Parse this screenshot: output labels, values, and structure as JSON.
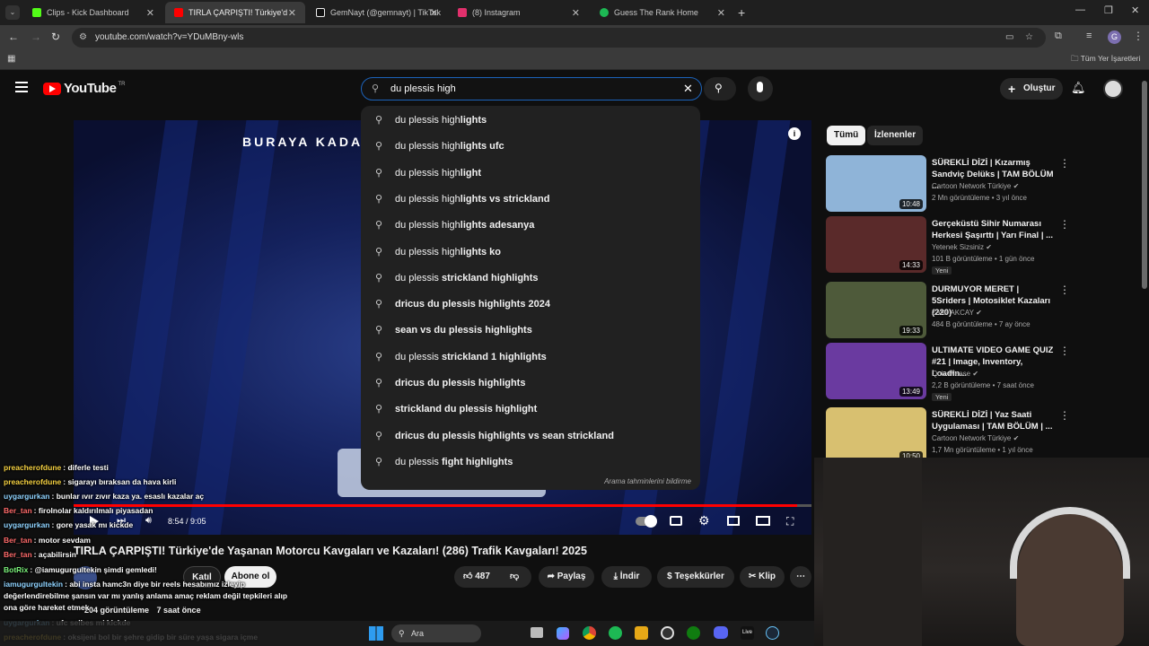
{
  "browser": {
    "tabs": [
      {
        "title": "Clips - Kick Dashboard",
        "icon": "kick-icon",
        "color": "#53fc18"
      },
      {
        "title": "TIRLA ÇARPIŞTI! Türkiye'de Yaşa",
        "icon": "youtube-icon",
        "color": "#ff0000",
        "active": true
      },
      {
        "title": "GemNayt (@gemnayt) | TikTok",
        "icon": "tiktok-icon",
        "color": "#ffffff"
      },
      {
        "title": "(8) Instagram",
        "icon": "instagram-icon",
        "color": "#e1306c"
      },
      {
        "title": "Guess The Rank Home",
        "icon": "spotify-icon",
        "color": "#1db954"
      }
    ],
    "url": "youtube.com/watch?v=YDuMBny-wls",
    "bookmarks_label": "Tüm Yer İşaretleri",
    "profile_initial": "G"
  },
  "header": {
    "logo_text": "YouTube",
    "country": "TR",
    "search_value": "du plessis high",
    "create_label": "Oluştur"
  },
  "suggestions": [
    {
      "pre": "du plessis high",
      "bold": "lights"
    },
    {
      "pre": "du plessis high",
      "bold": "lights ufc"
    },
    {
      "pre": "du plessis high",
      "bold": "light"
    },
    {
      "pre": "du plessis high",
      "bold": "lights vs strickland"
    },
    {
      "pre": "du plessis high",
      "bold": "lights adesanya"
    },
    {
      "pre": "du plessis high",
      "bold": "lights ko"
    },
    {
      "pre": "du plessis ",
      "bold": "strickland highlights"
    },
    {
      "pre": "",
      "bold": "dricus du plessis highlights 2024"
    },
    {
      "pre": "",
      "bold": "sean vs du plessis highlights"
    },
    {
      "pre": "du plessis ",
      "bold": "strickland 1 highlights"
    },
    {
      "pre": "",
      "bold": "dricus du plessis highlights"
    },
    {
      "pre": "",
      "bold": "strickland du plessis highlight"
    },
    {
      "pre": "",
      "bold": "dricus du plessis highlights vs sean strickland"
    },
    {
      "pre": "du plessis ",
      "bold": "fight highlights"
    }
  ],
  "suggest_footer": "Arama tahminlerini bildirme",
  "video": {
    "overlay_text": "BURAYA KADAR",
    "time": "8:54 / 9:05",
    "progress": 0.98,
    "title": "TIRLA ÇARPIŞTI! Türkiye'de Yaşanan Motorcu Kavgaları ve Kazaları! (286) Trafik Kavgaları! 2025",
    "join_label": "Katıl",
    "subscribe_label": "Abone ol",
    "likes": "487",
    "share_label": "Paylaş",
    "download_label": "İndir",
    "thanks_label": "Teşekkürler",
    "clip_label": "Klip",
    "views": "204 görüntüleme",
    "ago": "7 saat önce"
  },
  "chips": [
    "Tümü",
    "İzlenenler"
  ],
  "related": [
    {
      "title": "SÜREKLİ DİZİ | Kızarmış Sandviç Delüks | TAM BÖLÜM ...",
      "channel": "Cartoon Network Türkiye",
      "meta": "2 Mn görüntüleme • 3 yıl önce",
      "duration": "10:48",
      "badge": "",
      "thumb": "#8fb4d8"
    },
    {
      "title": "Gerçeküstü Sihir Numarası Herkesi Şaşırttı | Yarı Final | ...",
      "channel": "Yetenek Sizsiniz",
      "meta": "101 B görüntüleme • 1 gün önce",
      "duration": "14:33",
      "badge": "Yeni",
      "thumb": "#5a2a2a"
    },
    {
      "title": "DURMUYOR MERET | 5Sriders | Motosiklet Kazaları (220)",
      "channel": "Zafer AKCAY",
      "meta": "484 B görüntüleme • 7 ay önce",
      "duration": "19:33",
      "badge": "",
      "thumb": "#4e5a3a"
    },
    {
      "title": "ULTIMATE VIDEO GAME QUIZ #21 | Image, Inventory, Loadin...",
      "channel": "Quiz Please",
      "meta": "2,2 B görüntüleme • 7 saat önce",
      "duration": "13:49",
      "badge": "Yeni",
      "thumb": "#6a3aa0"
    },
    {
      "title": "SÜREKLİ DİZİ | Yaz Saati Uygulaması | TAM BÖLÜM | ...",
      "channel": "Cartoon Network Türkiye",
      "meta": "1,7 Mn görüntüleme • 1 yıl önce",
      "duration": "10:50",
      "badge": "",
      "thumb": "#d8c070"
    }
  ],
  "chat": [
    {
      "user": "preacherofdune",
      "msg": "diferle testi",
      "color": "#f5d142"
    },
    {
      "user": "preacherofdune",
      "msg": "sigarayı bıraksan da hava kirli",
      "color": "#f5d142"
    },
    {
      "user": "uygargurkan",
      "msg": "bunlar ıvır zıvır kaza ya. esaslı kazalar aç",
      "color": "#8fd3ff"
    },
    {
      "user": "Ber_tan",
      "msg": "firolnolar kaldırılmalı piyasadan",
      "color": "#ff6b6b"
    },
    {
      "user": "uygargurkan",
      "msg": "gore yasak mı kickde",
      "color": "#8fd3ff"
    },
    {
      "user": "Ber_tan",
      "msg": "motor sevdam",
      "color": "#ff6b6b"
    },
    {
      "user": "Ber_tan",
      "msg": "açabilirsin",
      "color": "#ff6b6b"
    },
    {
      "user": "BotRix",
      "msg": "@iamugurgultekin şimdi gemledi!",
      "color": "#7cf57c"
    },
    {
      "user": "iamugurgultekin",
      "msg": "abi insta hamc3n diye bir reels hesabımız izleyip",
      "color": "#8fd3ff"
    },
    {
      "user": "",
      "msg": "değerlendirebilme şansın var mı yanlış anlama amaç reklam değil tepkileri alıp",
      "color": "#ffffff"
    },
    {
      "user": "",
      "msg": "ona göre hareket etmek",
      "color": "#ffffff"
    },
    {
      "user": "uygargurkan",
      "msg": "ufc selbes mi kickde",
      "color": "#8fd3ff"
    },
    {
      "user": "preacherofdune",
      "msg": "oksijeni bol bir şehre gidip bir süre yaşa sigara içme",
      "color": "#f5d142"
    }
  ],
  "taskbar": {
    "search_label": "Ara"
  }
}
